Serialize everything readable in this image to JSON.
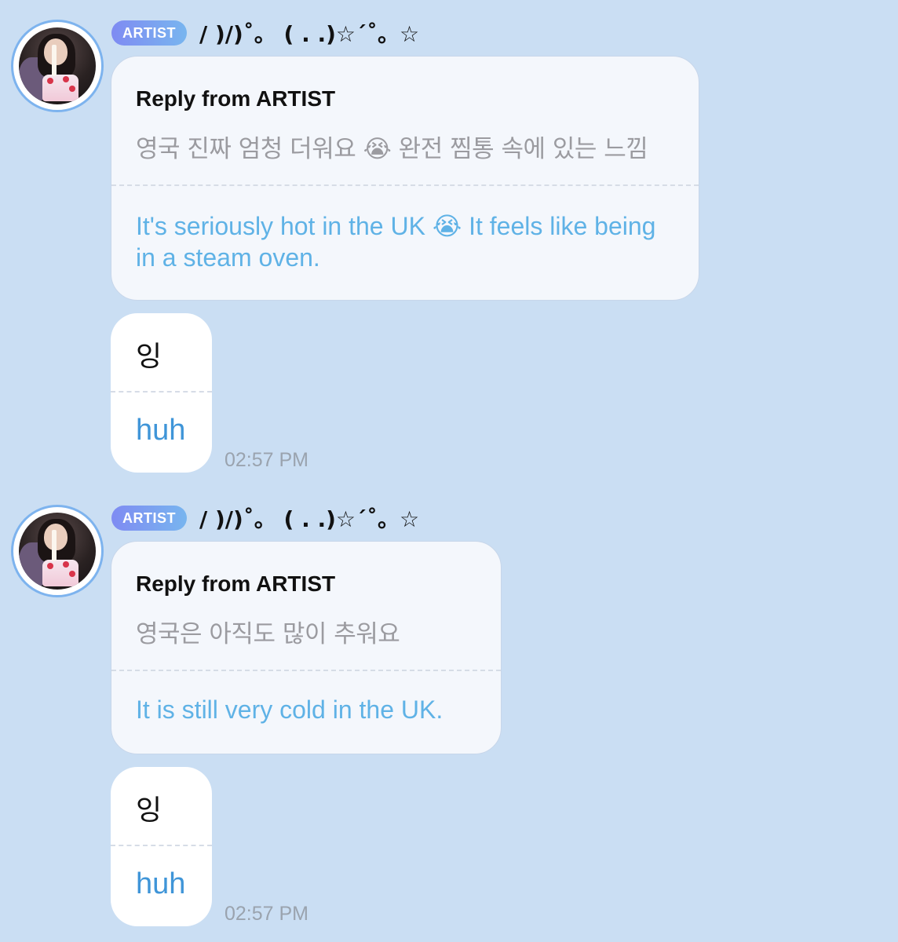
{
  "messages": [
    {
      "badge": "ARTIST",
      "sender_name": "/ )/)˚。 ( . .)☆´˚。☆",
      "reply": {
        "title": "Reply from ARTIST",
        "original": "영국 진짜 엄청 더워요 😭 완전 찜통 속에 있는 느낌",
        "translation": "It's seriously hot in the UK 😭 It feels like being in a steam oven."
      },
      "bubble": {
        "original": "잉",
        "translation": "huh"
      },
      "time": "02:57 PM"
    },
    {
      "badge": "ARTIST",
      "sender_name": "/ )/)˚。 ( . .)☆´˚。☆",
      "reply": {
        "title": "Reply from ARTIST",
        "original": "영국은 아직도 많이 추워요",
        "translation": "It is still very cold in the UK."
      },
      "bubble": {
        "original": "잉",
        "translation": "huh"
      },
      "time": "02:57 PM"
    }
  ],
  "colors": {
    "background": "#cadef3",
    "badge_start": "#7f8bf2",
    "badge_end": "#78b5ef",
    "translation_text": "#5fb2e6",
    "avatar_ring": "#7db3ee"
  }
}
